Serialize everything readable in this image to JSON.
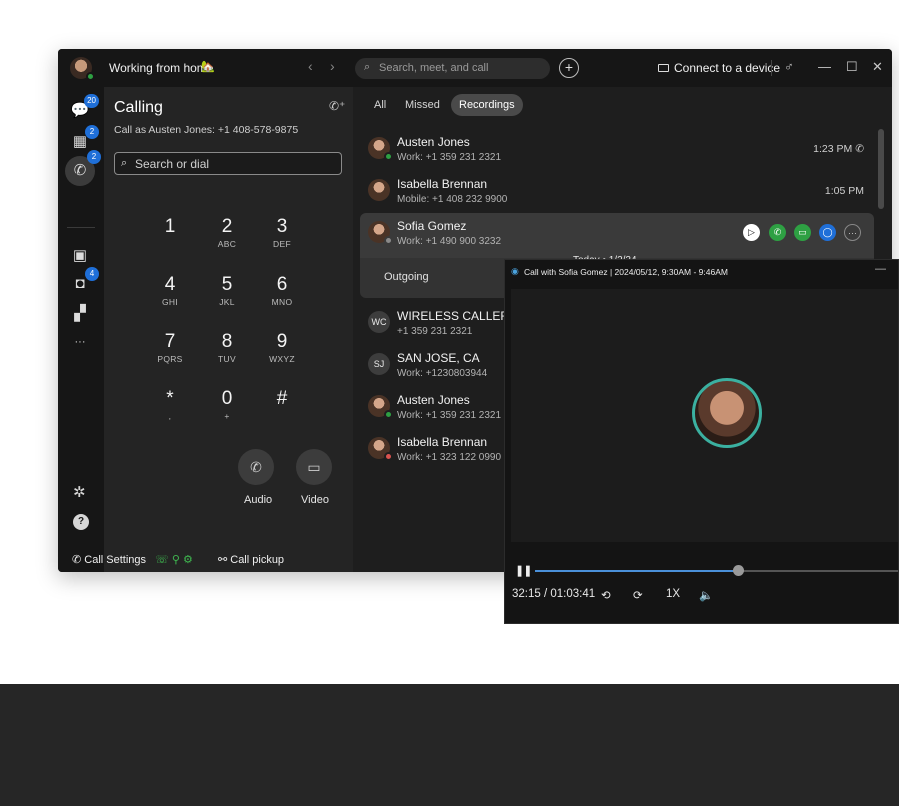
{
  "titlebar": {
    "status_text": "Working from home",
    "status_icon": "🏡",
    "back_glyph": "‹",
    "forward_glyph": "›",
    "search_placeholder": "Search, meet, and call",
    "new_glyph": "+",
    "connect_label": "Connect to a device",
    "window_controls": [
      "—",
      "☐",
      "✕"
    ]
  },
  "rail": {
    "items": [
      {
        "name": "messaging",
        "glyph": "💬",
        "badge": "20"
      },
      {
        "name": "meetings",
        "glyph": "▦",
        "badge": "2"
      },
      {
        "name": "calling",
        "glyph": "✆",
        "badge": "2"
      },
      {
        "name": "contacts",
        "glyph": "▣",
        "badge": ""
      },
      {
        "name": "voicemail",
        "glyph": "◘",
        "badge": "4"
      },
      {
        "name": "apps",
        "glyph": "▞",
        "badge": ""
      },
      {
        "name": "more",
        "glyph": "···",
        "badge": ""
      }
    ],
    "settings_glyph": "✲",
    "help_glyph": "?"
  },
  "calling": {
    "title": "Calling",
    "call_as": "Call as Austen Jones: +1 408-578-9875",
    "dial_placeholder": "Search or dial",
    "keys": [
      {
        "d": "1",
        "l": ""
      },
      {
        "d": "2",
        "l": "ABC"
      },
      {
        "d": "3",
        "l": "DEF"
      },
      {
        "d": "4",
        "l": "GHI"
      },
      {
        "d": "5",
        "l": "JKL"
      },
      {
        "d": "6",
        "l": "MNO"
      },
      {
        "d": "7",
        "l": "PQRS"
      },
      {
        "d": "8",
        "l": "TUV"
      },
      {
        "d": "9",
        "l": "WXYZ"
      },
      {
        "d": "*",
        "l": ","
      },
      {
        "d": "0",
        "l": "+"
      },
      {
        "d": "#",
        "l": ""
      }
    ],
    "audio_label": "Audio",
    "video_label": "Video"
  },
  "footer": {
    "call_settings": "Call Settings",
    "call_pickup": "Call pickup"
  },
  "history": {
    "tabs": [
      "All",
      "Missed",
      "Recordings"
    ],
    "selected_tab": "Recordings",
    "rows": [
      {
        "initials": "",
        "name": "Austen Jones",
        "number": "Work: +1 359 231 2321",
        "time": "1:23 PM",
        "presence": "#2ea043"
      },
      {
        "initials": "",
        "name": "Isabella Brennan",
        "number": "Mobile: +1 408 232 9900",
        "time": "1:05 PM",
        "presence": ""
      },
      {
        "initials": "",
        "name": "Sofia Gomez",
        "number": "Work: +1 490 900 3232",
        "time": "",
        "presence": "#8a8a8a"
      },
      {
        "initials": "WC",
        "name": "WIRELESS CALLER",
        "number": "+1 359 231 2321",
        "time": "",
        "presence": ""
      },
      {
        "initials": "SJ",
        "name": "SAN JOSE, CA",
        "number": "Work: +1230803944",
        "time": "",
        "presence": ""
      },
      {
        "initials": "",
        "name": "Austen Jones",
        "number": "Work: +1 359 231 2321",
        "time": "",
        "presence": "#2ea043"
      },
      {
        "initials": "",
        "name": "Isabella Brennan",
        "number": "Work: +1 323 122 0990",
        "time": "",
        "presence": "#d9534f"
      }
    ],
    "today_label": "Today • 1/2/24",
    "outgoing_label": "Outgoing"
  },
  "player": {
    "title": "Call with Sofia Gomez | 2024/05/12, 9:30AM - 9:46AM",
    "time_readout": "32:15 / 01:03:41",
    "speed": "1X",
    "progress": 0.506,
    "accent": "#4a90d9"
  }
}
